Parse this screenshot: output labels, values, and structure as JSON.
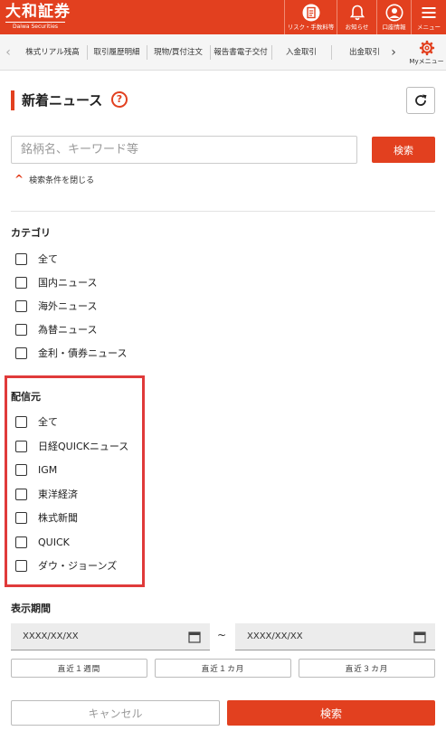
{
  "header": {
    "logo_text": "大和証券",
    "logo_sub": "Daiwa Securities",
    "buttons": [
      {
        "label": "リスク・手数料等",
        "icon": "document-icon"
      },
      {
        "label": "お知らせ",
        "icon": "bell-icon"
      },
      {
        "label": "口座情報",
        "icon": "user-icon"
      },
      {
        "label": "メニュー",
        "icon": "menu-icon"
      }
    ]
  },
  "subnav": {
    "items": [
      "株式リアル残高",
      "取引履歴明細",
      "現物/買付注文",
      "報告書電子交付",
      "入金取引",
      "出金取引"
    ],
    "mymenu_label": "Myメニュー"
  },
  "page": {
    "title": "新着ニュース",
    "help_symbol": "?"
  },
  "search": {
    "placeholder": "銘柄名、キーワード等",
    "button_label": "検索",
    "toggle_label": "検索条件を閉じる"
  },
  "category": {
    "heading": "カテゴリ",
    "options": [
      "全て",
      "国内ニュース",
      "海外ニュース",
      "為替ニュース",
      "金利・債券ニュース"
    ]
  },
  "source": {
    "heading": "配信元",
    "options": [
      "全て",
      "日経QUICKニュース",
      "IGM",
      "東洋経済",
      "株式新聞",
      "QUICK",
      "ダウ・ジョーンズ"
    ]
  },
  "period": {
    "heading": "表示期間",
    "from_value": "XXXX/XX/XX",
    "to_value": "XXXX/XX/XX",
    "separator": "~",
    "ranges": [
      "直近１週間",
      "直近１カ月",
      "直近３カ月"
    ]
  },
  "footer": {
    "cancel_label": "キャンセル",
    "submit_label": "検索"
  },
  "colors": {
    "brand": "#e2401f",
    "highlight": "#e03a3a"
  }
}
